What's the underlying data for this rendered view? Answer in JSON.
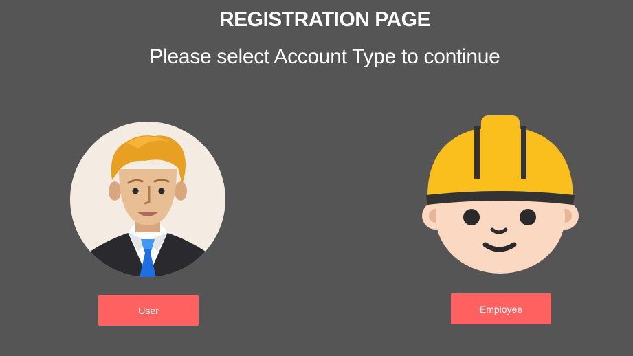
{
  "header": {
    "title": "REGISTRATION PAGE",
    "subtitle": "Please select Account Type to continue"
  },
  "accounts": [
    {
      "label": "User",
      "icon": "businessman-avatar-icon"
    },
    {
      "label": "Employee",
      "icon": "construction-worker-avatar-icon"
    }
  ],
  "colors": {
    "background": "#555555",
    "button": "#ff6060",
    "text": "#ffffff",
    "helmet": "#fbbf1d",
    "skin": "#fbd8c2"
  }
}
